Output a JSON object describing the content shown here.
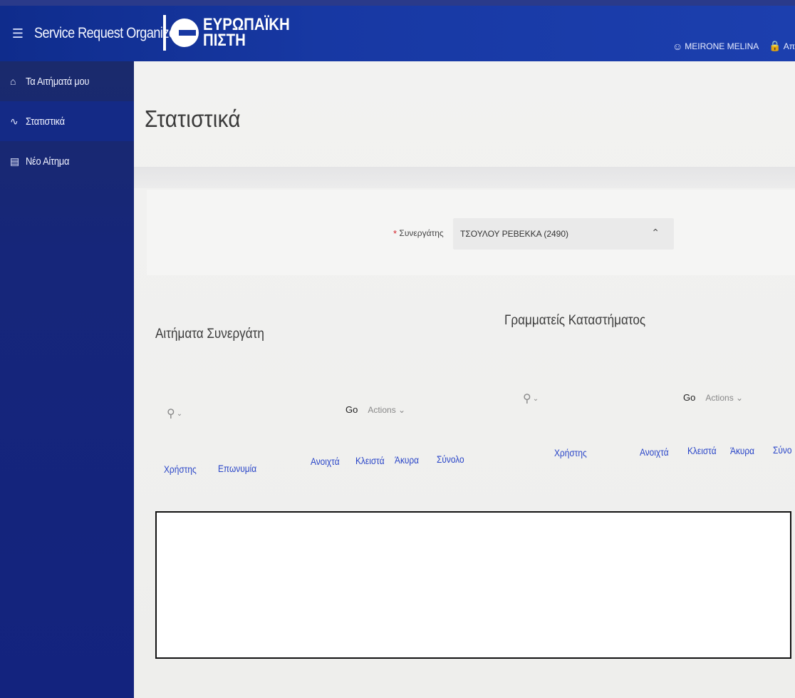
{
  "header": {
    "menu_icon": "hamburger-icon",
    "app_title": "Service Request Organizer",
    "logo_line1": "ΕΥΡΩΠΑΪΚΗ",
    "logo_line2": "ΠΙΣΤΗ",
    "user_name": "MEIRONE MELINA",
    "user_icon": "user-icon",
    "lock_icon": "lock-icon",
    "logout_text": "Απ"
  },
  "sidebar": {
    "items": [
      {
        "label": "Τα Αιτήματά μου",
        "icon": "home-icon",
        "active": false
      },
      {
        "label": "Στατιστικά",
        "icon": "chart-icon",
        "active": true
      },
      {
        "label": "Νέο Αίτημα",
        "icon": "folder-icon",
        "active": false
      }
    ]
  },
  "main": {
    "page_title": "Στατιστικά",
    "filter": {
      "label": "Συνεργάτης",
      "required_mark": "*",
      "value": "ΤΣΟΥΛΟΥ ΡΕΒΕΚΚΑ (2490)"
    },
    "left_region": {
      "title": "Αιτήματα Συνεργάτη",
      "go": "Go",
      "actions": "Actions",
      "columns": [
        "Χρήστης",
        "Επωνυμία",
        "Ανοιχτά",
        "Κλειστά",
        "Άκυρα",
        "Σύνολο"
      ]
    },
    "right_region": {
      "title": "Γραμματείς Καταστήματος",
      "go": "Go",
      "actions": "Actions",
      "columns": [
        "Χρήστης",
        "Ανοιχτά",
        "Κλειστά",
        "Άκυρα",
        "Σύνο"
      ]
    }
  },
  "colors": {
    "header_blue": "#1738a3",
    "sidebar_blue": "#13237e",
    "link_blue": "#2a46c8",
    "required_red": "#d3232a"
  }
}
